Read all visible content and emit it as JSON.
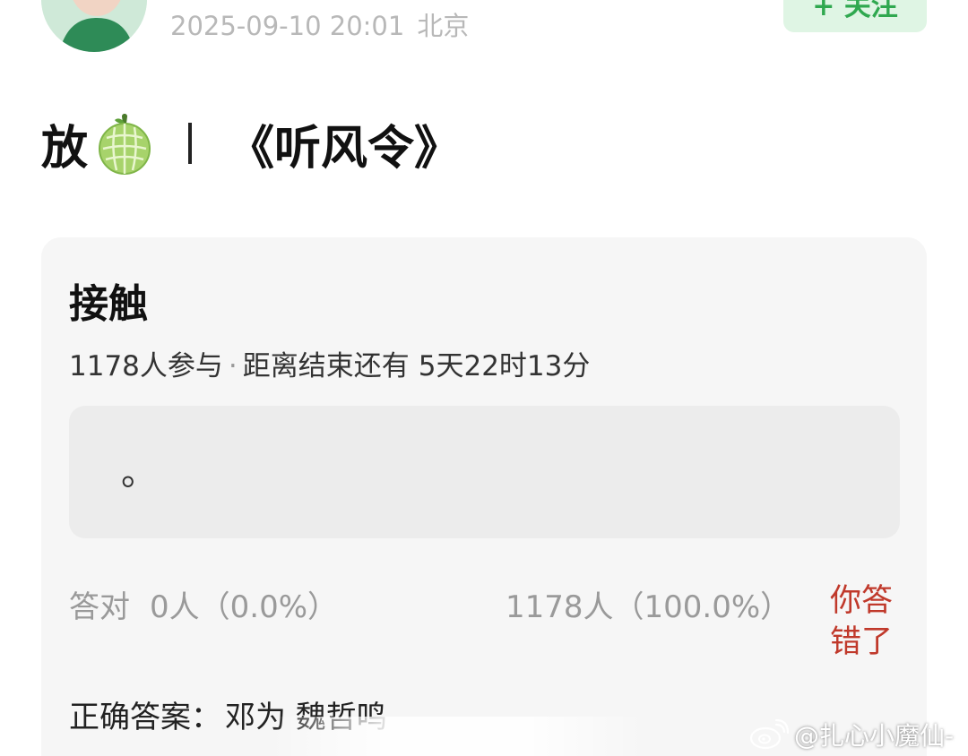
{
  "header": {
    "timestamp": "2025-09-10 20:01",
    "location": "北京",
    "follow_label": "+ 关注"
  },
  "post": {
    "title_prefix": "放",
    "title_emoji_icon": "melon-icon",
    "title_text": "《听风令》"
  },
  "quiz": {
    "title": "接触",
    "participants": "1178人参与",
    "separator": "·",
    "remaining_label": "距离结束还有",
    "remaining_time": "5天22时13分",
    "option_text": "。",
    "correct_label": "答对",
    "correct_count": "0人（0.0%）",
    "wrong_count": "1178人（100.0%）",
    "verdict": "你答错了",
    "answer_label": "正确答案：",
    "answer_value": "邓为 魏哲鸣"
  },
  "watermark": {
    "icon": "weibo-icon",
    "text": "@扎心小魔仙-"
  },
  "colors": {
    "follow_bg": "#dff5e4",
    "follow_text": "#2fa84f",
    "card_bg": "#f6f6f6",
    "option_bg": "#ececec",
    "verdict_red": "#c0392b",
    "muted_text": "#9a9a9a"
  }
}
